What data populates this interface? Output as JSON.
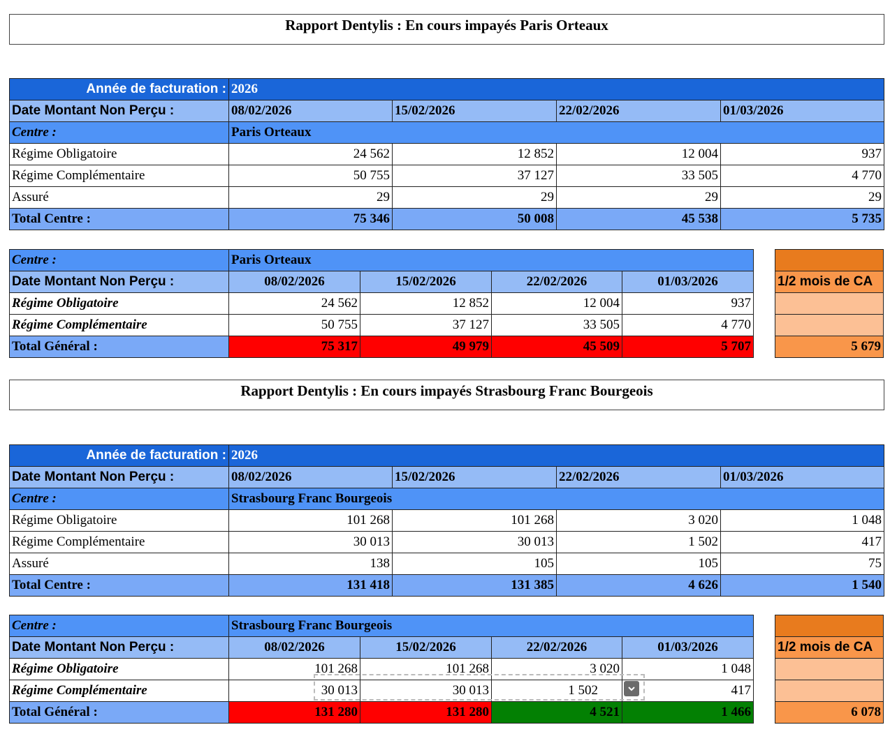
{
  "reports": [
    {
      "title": "Rapport Dentylis : En cours impayés Paris Orteaux",
      "year_label": "Année de facturation :",
      "year": "2026",
      "date_label": "Date Montant Non Perçu :",
      "dates": [
        "08/02/2026",
        "15/02/2026",
        "22/02/2026",
        "01/03/2026"
      ],
      "centre_label": "Centre :",
      "centre": "Paris Orteaux",
      "rows": [
        {
          "label": "Régime Obligatoire",
          "values": [
            "24 562",
            "12 852",
            "12 004",
            "937"
          ]
        },
        {
          "label": "Régime Complémentaire",
          "values": [
            "50 755",
            "37 127",
            "33 505",
            "4 770"
          ]
        },
        {
          "label": "Assuré",
          "values": [
            "29",
            "29",
            "29",
            "29"
          ]
        }
      ],
      "total_label": "Total Centre :",
      "totals": [
        "75 346",
        "50 008",
        "45 538",
        "5 735"
      ],
      "summary": {
        "centre_label": "Centre :",
        "centre": "Paris Orteaux",
        "date_label": "Date Montant Non Perçu :",
        "dates": [
          "08/02/2026",
          "15/02/2026",
          "22/02/2026",
          "01/03/2026"
        ],
        "rows": [
          {
            "label": "Régime Obligatoire",
            "values": [
              "24 562",
              "12 852",
              "12 004",
              "937"
            ]
          },
          {
            "label": "Régime Complémentaire",
            "values": [
              "50 755",
              "37 127",
              "33 505",
              "4 770"
            ]
          }
        ],
        "total_label": "Total Général :",
        "totals": [
          "75 317",
          "49 979",
          "45 509",
          "5 707"
        ],
        "total_colors": [
          "#ff0000",
          "#ff0000",
          "#ff0000",
          "#ff0000"
        ],
        "ca_label": "1/2 mois de CA",
        "ca_value": "5 679"
      }
    },
    {
      "title": "Rapport Dentylis : En cours impayés Strasbourg Franc Bourgeois",
      "year_label": "Année de facturation :",
      "year": "2026",
      "date_label": "Date Montant Non Perçu :",
      "dates": [
        "08/02/2026",
        "15/02/2026",
        "22/02/2026",
        "01/03/2026"
      ],
      "centre_label": "Centre :",
      "centre": "Strasbourg Franc Bourgeois",
      "rows": [
        {
          "label": "Régime Obligatoire",
          "values": [
            "101 268",
            "101 268",
            "3 020",
            "1 048"
          ]
        },
        {
          "label": "Régime Complémentaire",
          "values": [
            "30 013",
            "30 013",
            "1 502",
            "417"
          ]
        },
        {
          "label": "Assuré",
          "values": [
            "138",
            "105",
            "105",
            "75"
          ]
        }
      ],
      "total_label": "Total Centre :",
      "totals": [
        "131 418",
        "131 385",
        "4 626",
        "1 540"
      ],
      "summary": {
        "centre_label": "Centre :",
        "centre": "Strasbourg Franc Bourgeois",
        "date_label": "Date Montant Non Perçu :",
        "dates": [
          "08/02/2026",
          "15/02/2026",
          "22/02/2026",
          "01/03/2026"
        ],
        "rows": [
          {
            "label": "Régime Obligatoire",
            "values": [
              "101 268",
              "101 268",
              "3 020",
              "1 048"
            ]
          },
          {
            "label": "Régime Complémentaire",
            "values": [
              "30 013",
              "30 013",
              "1 502",
              "417"
            ]
          }
        ],
        "total_label": "Total Général :",
        "totals": [
          "131 280",
          "131 280",
          "4 521",
          "1 466"
        ],
        "total_colors": [
          "#ff0000",
          "#ff0000",
          "#038003",
          "#038003"
        ],
        "ca_label": "1/2 mois de CA",
        "ca_value": "6 078"
      }
    }
  ],
  "dropdown_icon": "chevron-down-icon"
}
